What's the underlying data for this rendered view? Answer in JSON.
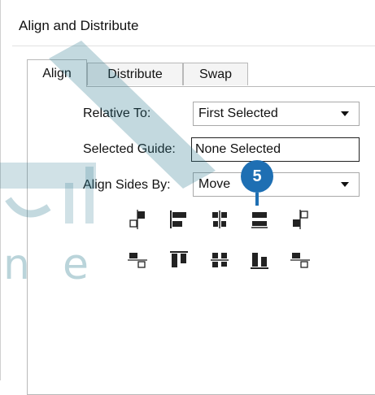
{
  "window": {
    "title": "Align and Distribute"
  },
  "tabs": [
    {
      "label": "Align",
      "active": true
    },
    {
      "label": "Distribute",
      "active": false
    },
    {
      "label": "Swap",
      "active": false
    }
  ],
  "fields": {
    "relative_to": {
      "label": "Relative To:",
      "value": "First Selected"
    },
    "selected_guide": {
      "label": "Selected Guide:",
      "value": "None Selected"
    },
    "align_sides_by": {
      "label": "Align Sides By:",
      "value": "Move"
    }
  },
  "align_buttons_row1": [
    {
      "icon": "align-left-outside-icon"
    },
    {
      "icon": "align-left-icon"
    },
    {
      "icon": "align-horizontal-center-icon"
    },
    {
      "icon": "align-right-icon"
    },
    {
      "icon": "align-right-outside-icon"
    }
  ],
  "align_buttons_row2": [
    {
      "icon": "align-top-outside-icon"
    },
    {
      "icon": "align-top-icon"
    },
    {
      "icon": "align-vertical-center-icon"
    },
    {
      "icon": "align-bottom-icon"
    },
    {
      "icon": "align-bottom-outside-icon"
    }
  ],
  "callout": {
    "number": "5",
    "color": "#1e6fb3"
  },
  "watermark": {
    "text": "ne"
  }
}
